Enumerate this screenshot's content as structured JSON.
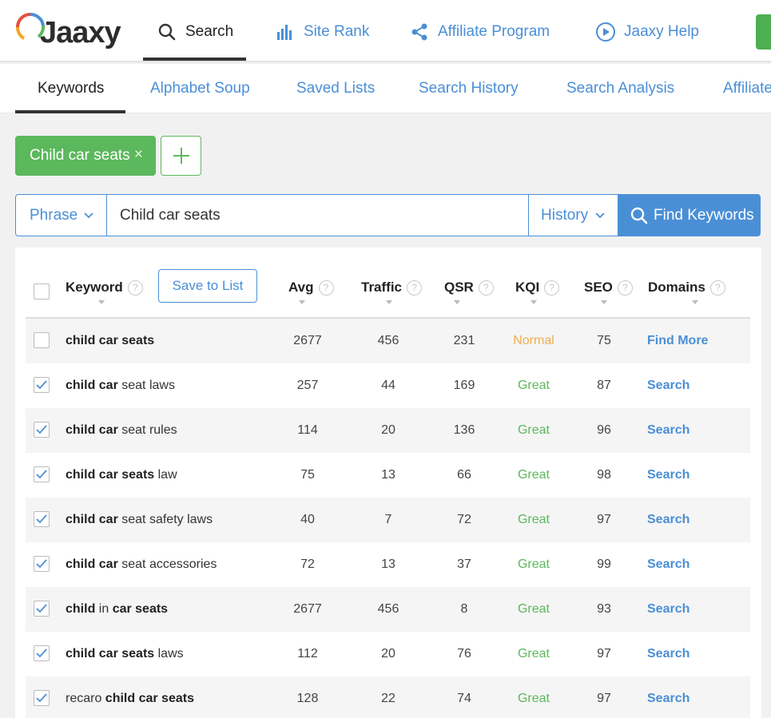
{
  "logo": {
    "text": "Jaaxy"
  },
  "nav": [
    {
      "label": "Search",
      "icon": "search-icon"
    },
    {
      "label": "Site Rank",
      "icon": "bar-chart-icon"
    },
    {
      "label": "Affiliate Program",
      "icon": "share-icon"
    },
    {
      "label": "Jaaxy Help",
      "icon": "play-circle-icon"
    }
  ],
  "subnav": [
    "Keywords",
    "Alphabet Soup",
    "Saved Lists",
    "Search History",
    "Search Analysis",
    "Affiliate"
  ],
  "tag": {
    "label": "Child car seats",
    "close": "×"
  },
  "search": {
    "mode": "Phrase",
    "query": "Child car seats",
    "history": "History",
    "find_label": "Find Keywords"
  },
  "table": {
    "save_label": "Save to List",
    "columns": [
      "Keyword",
      "Avg",
      "Traffic",
      "QSR",
      "KQI",
      "SEO",
      "Domains"
    ],
    "help_glyph": "?",
    "rows": [
      {
        "checked": false,
        "kw": [
          [
            "b",
            "child car seats"
          ]
        ],
        "avg": "2677",
        "traffic": "456",
        "qsr": "231",
        "kqi": "Normal",
        "seo": "75",
        "domains": "Find More"
      },
      {
        "checked": true,
        "kw": [
          [
            "b",
            "child car"
          ],
          [
            "n",
            " seat laws"
          ]
        ],
        "avg": "257",
        "traffic": "44",
        "qsr": "169",
        "kqi": "Great",
        "seo": "87",
        "domains": "Search"
      },
      {
        "checked": true,
        "kw": [
          [
            "b",
            "child car"
          ],
          [
            "n",
            " seat rules"
          ]
        ],
        "avg": "114",
        "traffic": "20",
        "qsr": "136",
        "kqi": "Great",
        "seo": "96",
        "domains": "Search"
      },
      {
        "checked": true,
        "kw": [
          [
            "b",
            "child car seats"
          ],
          [
            "n",
            " law"
          ]
        ],
        "avg": "75",
        "traffic": "13",
        "qsr": "66",
        "kqi": "Great",
        "seo": "98",
        "domains": "Search"
      },
      {
        "checked": true,
        "kw": [
          [
            "b",
            "child car"
          ],
          [
            "n",
            " seat safety laws"
          ]
        ],
        "avg": "40",
        "traffic": "7",
        "qsr": "72",
        "kqi": "Great",
        "seo": "97",
        "domains": "Search"
      },
      {
        "checked": true,
        "kw": [
          [
            "b",
            "child car"
          ],
          [
            "n",
            " seat accessories"
          ]
        ],
        "avg": "72",
        "traffic": "13",
        "qsr": "37",
        "kqi": "Great",
        "seo": "99",
        "domains": "Search"
      },
      {
        "checked": true,
        "kw": [
          [
            "b",
            "child"
          ],
          [
            "n",
            " in "
          ],
          [
            "b",
            "car seats"
          ]
        ],
        "avg": "2677",
        "traffic": "456",
        "qsr": "8",
        "kqi": "Great",
        "seo": "93",
        "domains": "Search"
      },
      {
        "checked": true,
        "kw": [
          [
            "b",
            "child car seats"
          ],
          [
            "n",
            " laws"
          ]
        ],
        "avg": "112",
        "traffic": "20",
        "qsr": "76",
        "kqi": "Great",
        "seo": "97",
        "domains": "Search"
      },
      {
        "checked": true,
        "kw": [
          [
            "n",
            "recaro "
          ],
          [
            "b",
            "child car seats"
          ]
        ],
        "avg": "128",
        "traffic": "22",
        "qsr": "74",
        "kqi": "Great",
        "seo": "97",
        "domains": "Search"
      }
    ]
  },
  "colors": {
    "accent": "#4a8fd6",
    "green": "#5cb85c",
    "orange": "#f0ad4e"
  }
}
